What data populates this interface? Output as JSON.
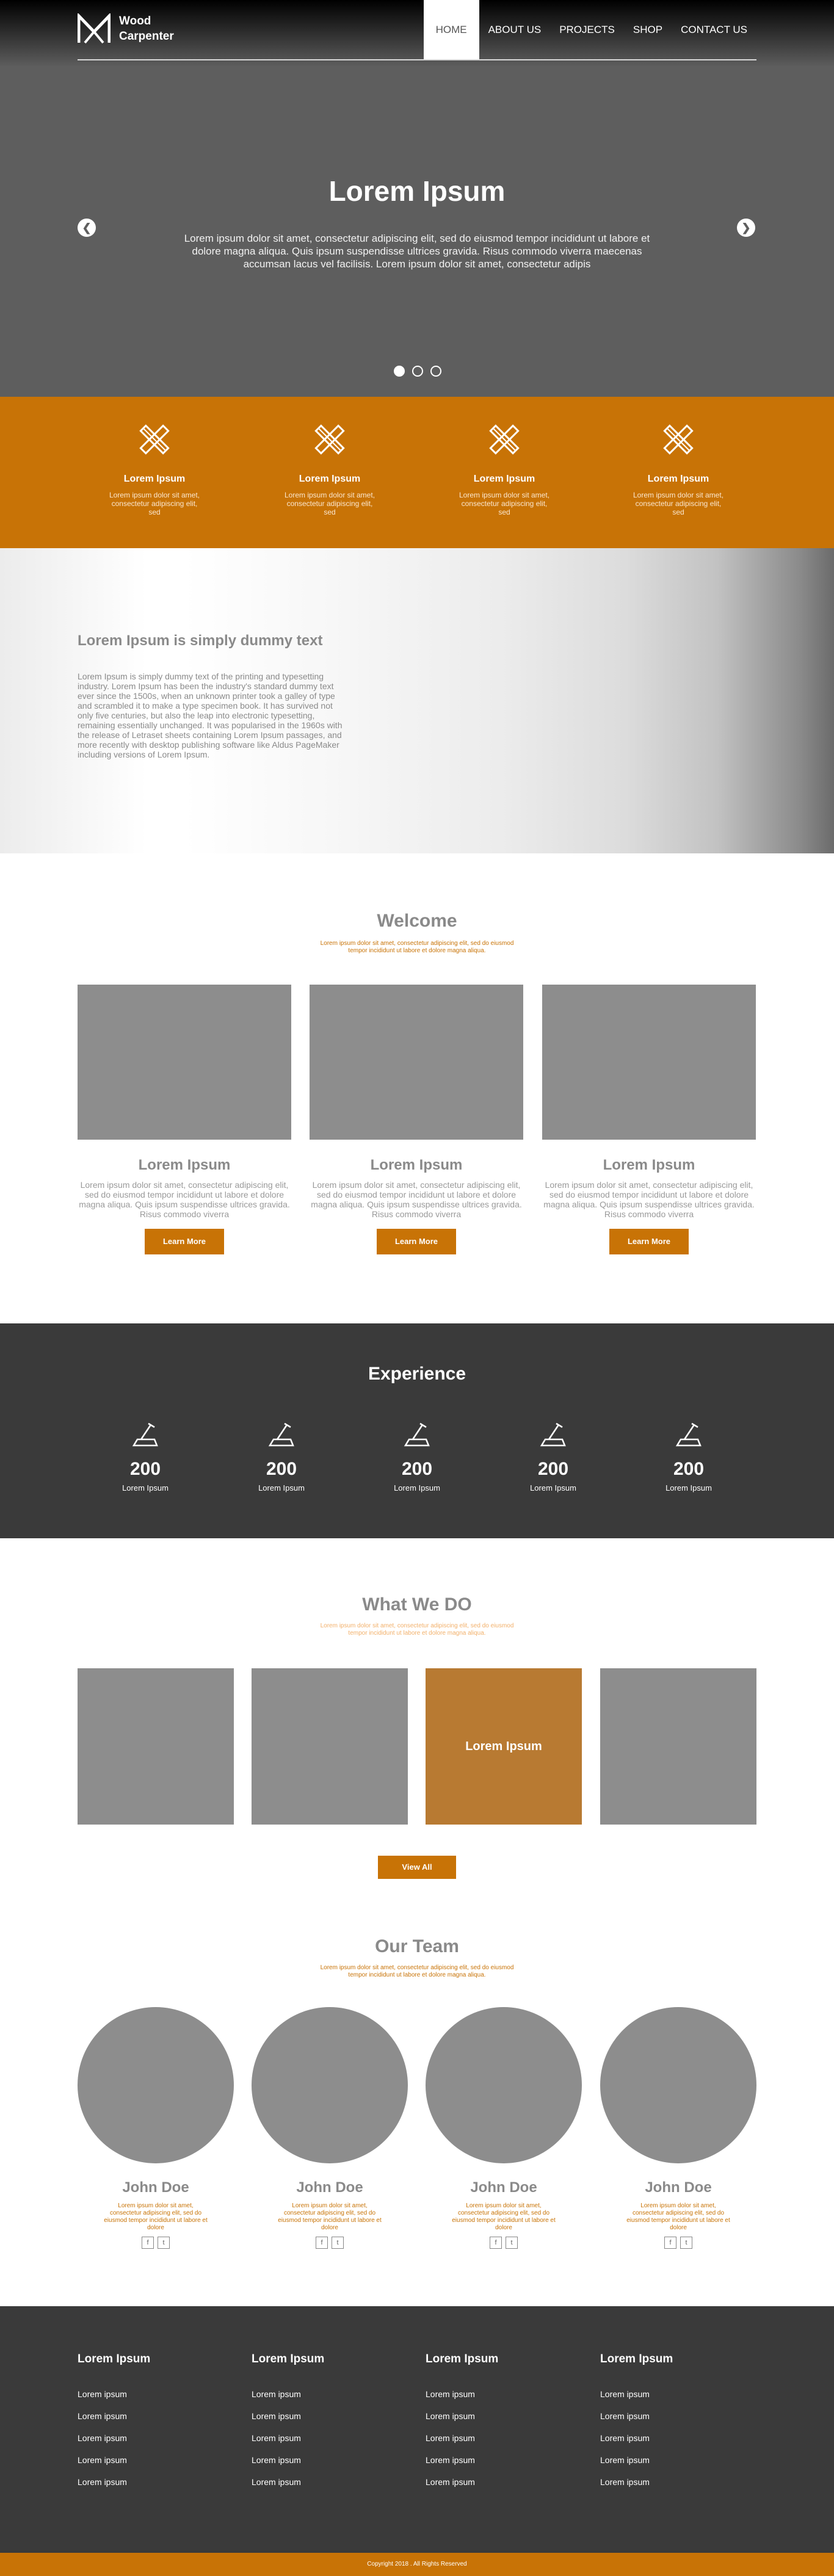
{
  "brand": {
    "line1": "Wood",
    "line2": "Carpenter"
  },
  "nav": {
    "items": [
      "HOME",
      "ABOUT US",
      "PROJECTS",
      "SHOP",
      "CONTACT US"
    ],
    "active": "HOME"
  },
  "hero": {
    "title": "Lorem Ipsum",
    "text": "Lorem ipsum dolor sit amet, consectetur adipiscing elit, sed do eiusmod tempor incididunt ut labore et dolore magna aliqua. Quis ipsum suspendisse ultrices gravida. Risus commodo viverra maecenas accumsan lacus vel facilisis. Lorem ipsum dolor sit amet, consectetur adipis",
    "slides": 3,
    "active_slide": 1
  },
  "services": [
    {
      "title": "Lorem Ipsum",
      "text": "Lorem ipsum dolor sit amet, consectetur adipiscing elit, sed"
    },
    {
      "title": "Lorem Ipsum",
      "text": "Lorem ipsum dolor sit amet, consectetur adipiscing elit, sed"
    },
    {
      "title": "Lorem Ipsum",
      "text": "Lorem ipsum dolor sit amet, consectetur adipiscing elit, sed"
    },
    {
      "title": "Lorem Ipsum",
      "text": "Lorem ipsum dolor sit amet, consectetur adipiscing elit, sed"
    }
  ],
  "about": {
    "title": "Lorem Ipsum is simply dummy text",
    "text": "Lorem Ipsum is simply dummy text of the printing and typesetting industry. Lorem Ipsum has been the industry's standard dummy text ever since the 1500s, when an unknown printer took a galley of type and scrambled it to make a type specimen book. It has survived not only five centuries, but also the leap into electronic typesetting, remaining essentially unchanged. It was popularised in the 1960s with the release of Letraset sheets containing Lorem Ipsum passages, and more recently with desktop publishing software like Aldus PageMaker including versions of Lorem Ipsum."
  },
  "welcome": {
    "title": "Welcome",
    "subtitle": "Lorem ipsum dolor sit amet, consectetur adipiscing elit, sed do eiusmod tempor incididunt ut labore et dolore magna aliqua.",
    "cards": [
      {
        "title": "Lorem Ipsum",
        "text": "Lorem ipsum dolor sit amet, consectetur adipiscing elit, sed do eiusmod tempor incididunt ut labore et dolore magna aliqua. Quis ipsum suspendisse ultrices gravida. Risus commodo viverra",
        "button": "Learn More"
      },
      {
        "title": "Lorem Ipsum",
        "text": "Lorem ipsum dolor sit amet, consectetur adipiscing elit, sed do eiusmod tempor incididunt ut labore et dolore magna aliqua. Quis ipsum suspendisse ultrices gravida. Risus commodo viverra",
        "button": "Learn More"
      },
      {
        "title": "Lorem Ipsum",
        "text": "Lorem ipsum dolor sit amet, consectetur adipiscing elit, sed do eiusmod tempor incididunt ut labore et dolore magna aliqua. Quis ipsum suspendisse ultrices gravida. Risus commodo viverra",
        "button": "Learn More"
      }
    ]
  },
  "experience": {
    "title": "Experience",
    "stats": [
      {
        "value": "200",
        "label": "Lorem Ipsum"
      },
      {
        "value": "200",
        "label": "Lorem Ipsum"
      },
      {
        "value": "200",
        "label": "Lorem Ipsum"
      },
      {
        "value": "200",
        "label": "Lorem Ipsum"
      },
      {
        "value": "200",
        "label": "Lorem Ipsum"
      }
    ]
  },
  "what_we_do": {
    "title": "What We DO",
    "subtitle": "Lorem ipsum dolor sit amet, consectetur adipiscing elit, sed do eiusmod tempor incididunt ut labore et dolore magna aliqua.",
    "highlight_label": "Lorem Ipsum",
    "button": "View All"
  },
  "team": {
    "title": "Our Team",
    "subtitle": "Lorem ipsum dolor sit amet, consectetur adipiscing elit, sed do eiusmod tempor incididunt ut labore et dolore magna aliqua.",
    "members": [
      {
        "name": "John Doe",
        "text": "Lorem ipsum dolor sit amet, consectetur adipiscing elit, sed do eiusmod tempor incididunt ut labore et dolore"
      },
      {
        "name": "John Doe",
        "text": "Lorem ipsum dolor sit amet, consectetur adipiscing elit, sed do eiusmod tempor incididunt ut labore et dolore"
      },
      {
        "name": "John Doe",
        "text": "Lorem ipsum dolor sit amet, consectetur adipiscing elit, sed do eiusmod tempor incididunt ut labore et dolore"
      },
      {
        "name": "John Doe",
        "text": "Lorem ipsum dolor sit amet, consectetur adipiscing elit, sed do eiusmod tempor incididunt ut labore et dolore"
      }
    ],
    "social_icons": [
      "facebook-icon",
      "twitter-icon"
    ]
  },
  "footer": {
    "columns": [
      {
        "title": "Lorem Ipsum",
        "links": [
          "Lorem ipsum",
          "Lorem ipsum",
          "Lorem ipsum",
          "Lorem ipsum",
          "Lorem ipsum"
        ]
      },
      {
        "title": "Lorem Ipsum",
        "links": [
          "Lorem ipsum",
          "Lorem ipsum",
          "Lorem ipsum",
          "Lorem ipsum",
          "Lorem ipsum"
        ]
      },
      {
        "title": "Lorem Ipsum",
        "links": [
          "Lorem ipsum",
          "Lorem ipsum",
          "Lorem ipsum",
          "Lorem ipsum",
          "Lorem ipsum"
        ]
      },
      {
        "title": "Lorem Ipsum",
        "links": [
          "Lorem ipsum",
          "Lorem ipsum",
          "Lorem ipsum",
          "Lorem ipsum",
          "Lorem ipsum"
        ]
      }
    ],
    "copyright": "Copyright 2018 . All Rights Reserved"
  },
  "colors": {
    "accent": "#c87306",
    "dark": "#3a3a3a",
    "placeholder": "#8d8d8d",
    "tile_highlight": "#b87a32"
  },
  "icons": {
    "service": "pencil-ruler-icon",
    "stat": "carpenter-plane-icon",
    "logo": "wood-carpenter-logo"
  }
}
